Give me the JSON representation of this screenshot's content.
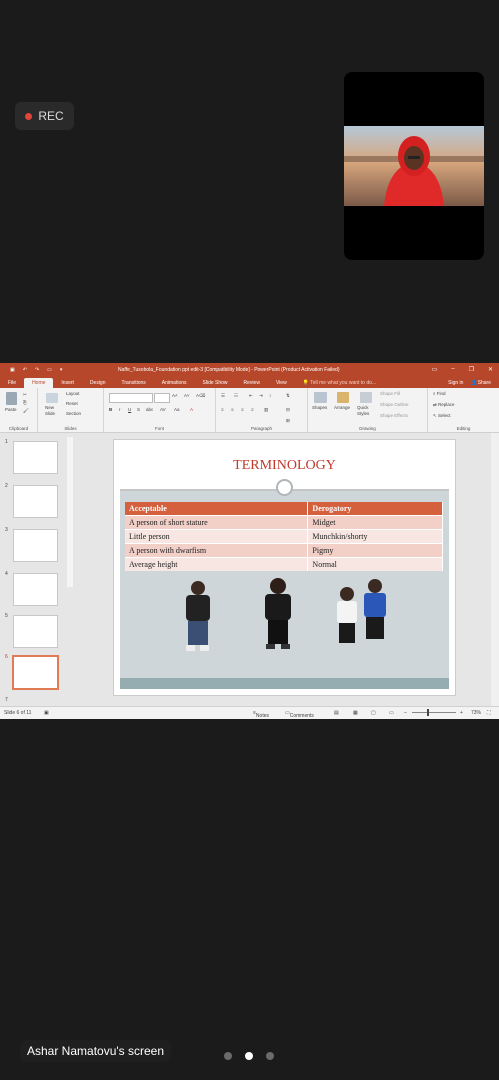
{
  "recording": {
    "label": "REC"
  },
  "screen_share": {
    "owner_label": "Ashar Namatovu's screen",
    "pages": 3,
    "active_page": 2
  },
  "ppt": {
    "window_title": "Naffe_Tusobola_Foundation ppt edit-3 [Compatibility Mode] - PowerPoint (Product Activation Failed)",
    "tabs": [
      "File",
      "Home",
      "Insert",
      "Design",
      "Transitions",
      "Animations",
      "Slide Show",
      "Review",
      "View"
    ],
    "active_tab": "Home",
    "tell_me": "Tell me what you want to do...",
    "sign_in": "Sign in",
    "share": "Share",
    "ribbon": {
      "clipboard": {
        "group": "Clipboard",
        "paste": "Paste"
      },
      "slides": {
        "group": "Slides",
        "new_slide": "New Slide",
        "layout": "Layout",
        "reset": "Reset",
        "section": "Section"
      },
      "font": {
        "group": "Font"
      },
      "paragraph": {
        "group": "Paragraph"
      },
      "drawing": {
        "group": "Drawing",
        "shapes": "Shapes",
        "arrange": "Arrange",
        "quick_styles": "Quick Styles",
        "shape_fill": "Shape Fill",
        "shape_outline": "Shape Outline",
        "shape_effects": "Shape Effects"
      },
      "editing": {
        "group": "Editing",
        "find": "Find",
        "replace": "Replace",
        "select": "Select"
      }
    },
    "thumbnails": [
      "1",
      "2",
      "3",
      "4",
      "5",
      "6",
      "7"
    ],
    "selected_slide": "6",
    "slide": {
      "title": "TERMINOLOGY",
      "table": {
        "headers": [
          "Acceptable",
          "Derogatory"
        ],
        "rows": [
          [
            "A person of short stature",
            "Midget"
          ],
          [
            "Little person",
            "Munchkin/shorty"
          ],
          [
            "A person with dwarfism",
            "Pigmy"
          ],
          [
            "Average height",
            "Normal"
          ]
        ]
      }
    },
    "status": {
      "slide_info": "Slide 6 of 11",
      "notes": "Notes",
      "comments": "Comments",
      "zoom": "73%"
    }
  }
}
